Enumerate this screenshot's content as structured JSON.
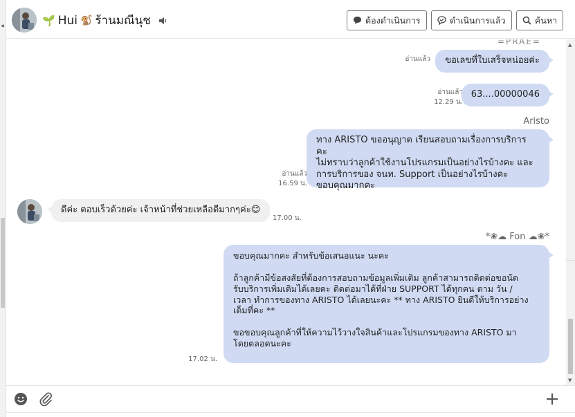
{
  "header": {
    "contact_name": "Hui",
    "shop_name": "ร้านมณีนุช",
    "name_prefix_icon": "seedling-icon",
    "shop_prefix_icon": "monkey-icon",
    "buttons": {
      "todo": "ต้องดำเนินการ",
      "done": "ดำเนินการแล้ว",
      "search": "ค้นหา"
    }
  },
  "messages": {
    "top_partial_sender": "=PRAE=",
    "m1": {
      "text": "ขอเลขที่ใบเสร็จหน่อยค่ะ",
      "read": "อ่านแล้ว"
    },
    "m2": {
      "text": "63....00000046",
      "read": "อ่านแล้ว",
      "time": "12.29 น."
    },
    "m3": {
      "sender": "Aristo",
      "text": "ทาง ARISTO ขออนุญาต เรียนสอบถามเรื่องการบริการ คะ\nไม่ทราบว่าลูกค้าใช้งานโปรแกรมเป็นอย่างไรบ้างคะ และ\nการบริการของ จนท. Support เป็นอย่างไรบ้างคะ\nขอบคุณมากคะ",
      "read": "อ่านแล้ว",
      "time": "16.59 น."
    },
    "m4": {
      "text": "ดีค่ะ ตอบเร็วด้วยค่ะ เจ้าหน้าที่ช่วยเหลือดีมากๆค่ะ😊",
      "time": "17.00 น."
    },
    "m5": {
      "sender": "*❀☁ Fon ☁❀*",
      "text": "ขอบคุณมากคะ สำหรับข้อเสนอแนะ นะคะ\n\nถ้าลูกค้ามีข้อสงสัยที่ต้องการสอบถามข้อมูลเพิ่มเติม ลูกค้าสามารถติดต่อขอนัด\nรับบริการเพิ่มเติมได้เลยคะ ติดต่อมาได้ที่ฝ่าย SUPPORT ได้ทุกคน ตาม วัน /\nเวลา ทำการของทาง ARISTO ได้เลยนะคะ ** ทาง ARISTO ยินดีให้บริการอย่าง\nเต็มที่คะ **\n\nขอขอบคุณลูกค้าที่ให้ความไว้วางใจสินค้าและโปรแกรมของทาง ARISTO มา\nโดยตลอดนะคะ",
      "time": "17.02 น."
    }
  },
  "composer": {
    "emoji_icon": "smiley-icon",
    "attach_icon": "paperclip-icon",
    "add_icon": "plus-icon"
  },
  "colors": {
    "outgoing_bubble": "#d0dbf3",
    "incoming_bubble": "#f0f0f0",
    "button_border": "#777777"
  }
}
